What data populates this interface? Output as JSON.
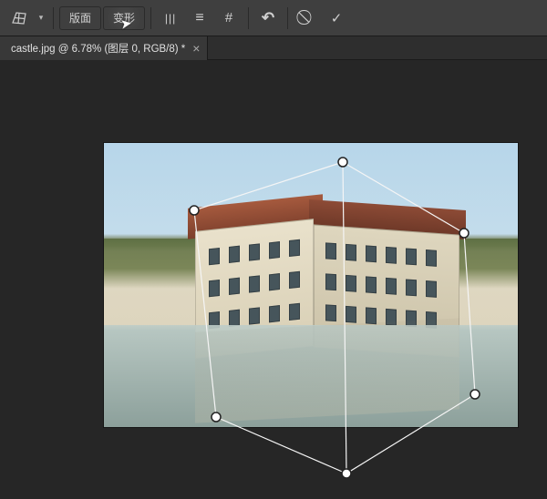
{
  "toolbar": {
    "panel_label": "版面",
    "warp_label": "变形"
  },
  "tab": {
    "title": "castle.jpg @ 6.78% (图层 0, RGB/8) *"
  },
  "icons": {
    "perspective": "perspective-grid-icon",
    "vertical_bars": "|||",
    "horizontal_bars": "≡",
    "hash": "#",
    "undo": "↶",
    "cancel": "⃠",
    "commit": "✓",
    "chevron": "▾"
  }
}
